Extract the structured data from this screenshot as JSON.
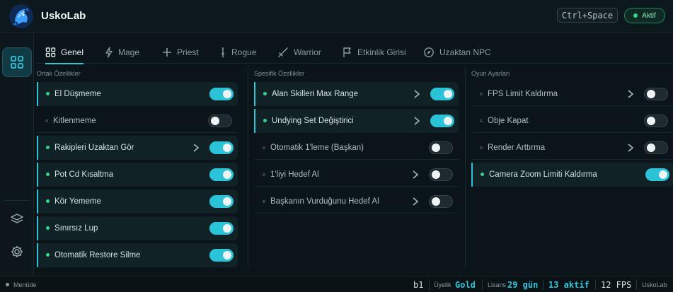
{
  "app": {
    "title": "UskoLab"
  },
  "header": {
    "shortcut": "Ctrl+Space",
    "status": "Aktif",
    "status_color": "#33d48c"
  },
  "rail": {
    "items": [
      {
        "icon": "grid-icon",
        "active": true
      },
      {
        "icon": "layers-icon",
        "active": false
      },
      {
        "icon": "gear-icon",
        "active": false
      }
    ]
  },
  "tabs": [
    {
      "label": "Genel",
      "icon": "grid-icon",
      "active": true
    },
    {
      "label": "Mage",
      "icon": "lightning-icon"
    },
    {
      "label": "Priest",
      "icon": "plus-icon"
    },
    {
      "label": "Rogue",
      "icon": "dagger-icon"
    },
    {
      "label": "Warrior",
      "icon": "sword-icon"
    },
    {
      "label": "Etkinlik Girisi",
      "icon": "flag-icon"
    },
    {
      "label": "Uzaktan NPC",
      "icon": "compass-icon"
    }
  ],
  "columns": {
    "ortak": {
      "title": "Ortak Özellikler",
      "items": [
        {
          "label": "El Düşmeme",
          "on": true,
          "chevron": false
        },
        {
          "label": "Kitlenmeme",
          "on": false,
          "chevron": false
        },
        {
          "label": "Rakipleri Uzaktan Gör",
          "on": true,
          "chevron": true
        },
        {
          "label": "Pot Cd Kısaltma",
          "on": true,
          "chevron": false
        },
        {
          "label": "Kör Yememe",
          "on": true,
          "chevron": false
        },
        {
          "label": "Sınırsız Lup",
          "on": true,
          "chevron": false
        },
        {
          "label": "Otomatik Restore Silme",
          "on": true,
          "chevron": false
        }
      ]
    },
    "spesifik": {
      "title": "Spesifik Özellikler",
      "items": [
        {
          "label": "Alan Skilleri Max Range",
          "on": true,
          "chevron": true
        },
        {
          "label": "Undying Set Değiştirici",
          "on": true,
          "chevron": true
        },
        {
          "label": "Otomatik 1'leme (Başkan)",
          "on": false,
          "chevron": false
        },
        {
          "label": "1'liyi Hedef Al",
          "on": false,
          "chevron": true
        },
        {
          "label": "Başkanın Vurduğunu Hedef Al",
          "on": false,
          "chevron": true
        }
      ]
    },
    "oyun": {
      "title": "Oyun Ayarları",
      "items": [
        {
          "label": "FPS Limit Kaldırma",
          "on": false,
          "chevron": true
        },
        {
          "label": "Obje Kapat",
          "on": false,
          "chevron": false
        },
        {
          "label": "Render Arttırma",
          "on": false,
          "chevron": true
        },
        {
          "label": "Camera Zoom Limiti Kaldırma",
          "on": true,
          "chevron": false
        }
      ]
    }
  },
  "footer": {
    "menu_label": "Menüde",
    "version": "b1",
    "membership_label": "Üyelik",
    "membership_value": "Gold",
    "license_label": "Lisans",
    "license_value": "29 gün",
    "active_value": "13 aktif",
    "fps_value": "12 FPS",
    "brand": "UskoLab"
  },
  "colors": {
    "accent": "#2ec5da",
    "active_dot": "#33d48c",
    "background": "#0b1419"
  }
}
